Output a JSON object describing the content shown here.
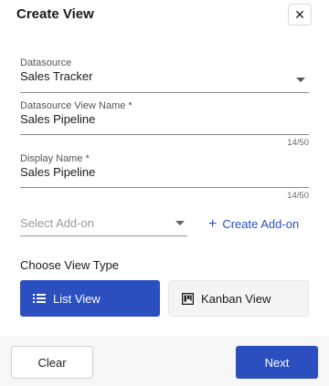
{
  "dialog": {
    "title": "Create View",
    "close_icon": "close-icon"
  },
  "form": {
    "datasource": {
      "label": "Datasource",
      "value": "Sales Tracker"
    },
    "datasource_view_name": {
      "label": "Datasource View Name *",
      "value": "Sales Pipeline",
      "counter": "14/50"
    },
    "display_name": {
      "label": "Display Name *",
      "value": "Sales Pipeline",
      "counter": "14/50"
    },
    "addon": {
      "placeholder": "Select Add-on",
      "create_label": "Create Add-on"
    }
  },
  "view_type": {
    "label": "Choose View Type",
    "options": [
      {
        "label": "List View",
        "icon": "list-icon",
        "selected": true
      },
      {
        "label": "Kanban View",
        "icon": "kanban-icon",
        "selected": false
      }
    ]
  },
  "footer": {
    "clear_label": "Clear",
    "next_label": "Next"
  },
  "colors": {
    "primary": "#2b4fbf",
    "footer_bg": "#f7f7f7"
  }
}
